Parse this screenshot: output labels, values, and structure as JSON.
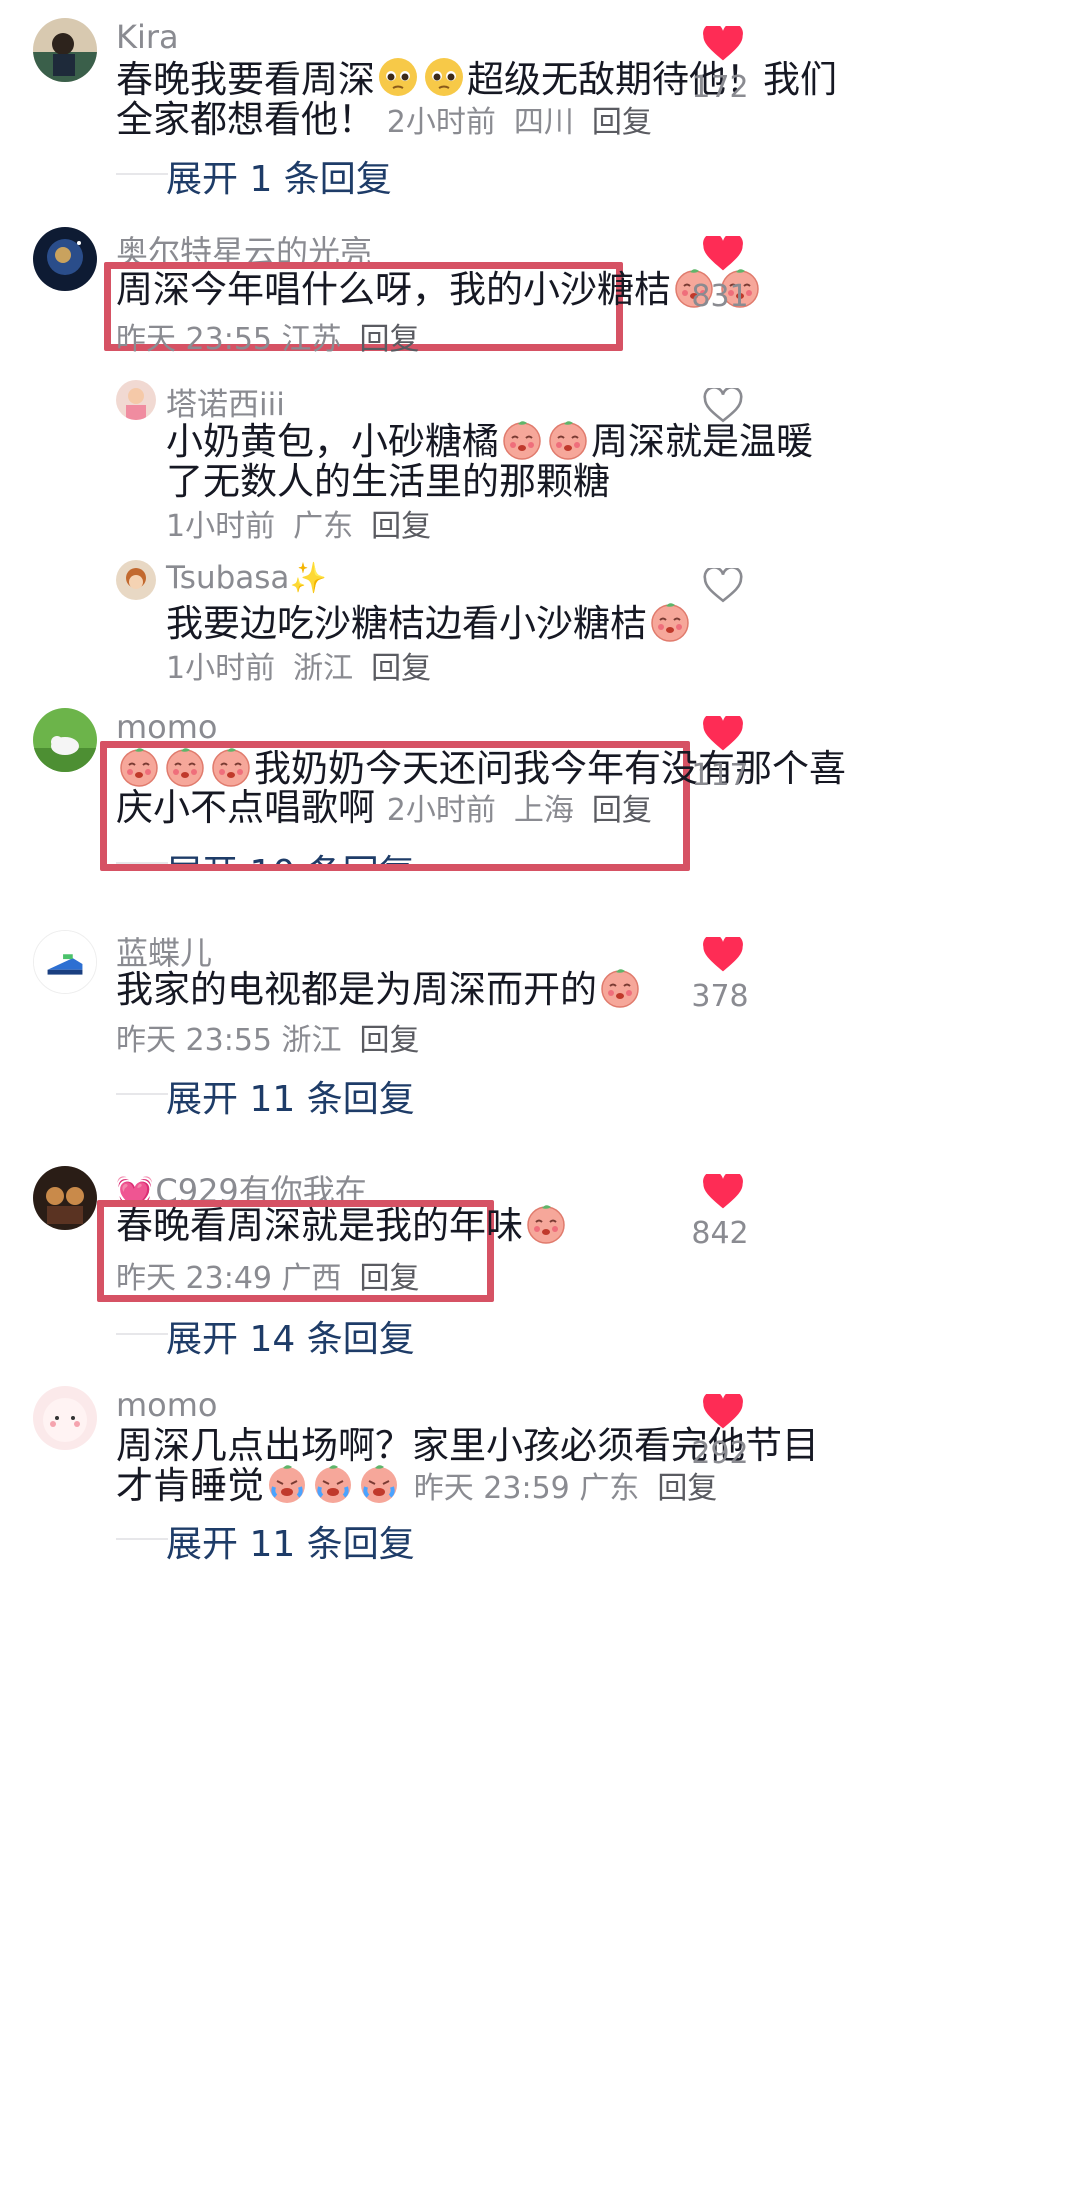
{
  "comments": [
    {
      "username": "Kira",
      "text_1": "春晚我要看周深",
      "text_2": "超级无敌期待他！我们",
      "text_3": "全家都想看他！",
      "time": "2小时前",
      "location": "四川",
      "reply": "回复",
      "expand": "展开 1 条回复",
      "likes": "172",
      "liked": true
    },
    {
      "username": "奥尔特星云的光亮",
      "text_1": "周深今年唱什么呀，我的小沙糖桔",
      "time": "昨天 23:55",
      "location": "江苏",
      "reply": "回复",
      "likes": "831",
      "liked": true,
      "replies": [
        {
          "username": "塔诺西iii",
          "text_1": "小奶黄包，小砂糖橘",
          "text_2": "周深就是温暖",
          "text_3": "了无数人的生活里的那颗糖",
          "time": "1小时前",
          "location": "广东",
          "reply": "回复",
          "liked": false
        },
        {
          "username": "Tsubasa",
          "text_1": "我要边吃沙糖桔边看小沙糖桔",
          "time": "1小时前",
          "location": "浙江",
          "reply": "回复",
          "liked": false
        }
      ]
    },
    {
      "username": "momo",
      "text_1": "我奶奶今天还问我今年有没有那个喜",
      "text_2": "庆小不点唱歌啊",
      "time": "2小时前",
      "location": "上海",
      "reply": "回复",
      "expand": "展开 10 条回复",
      "likes": "117",
      "liked": true
    },
    {
      "username": "蓝蝶儿",
      "text_1": "我家的电视都是为周深而开的",
      "time": "昨天 23:55",
      "location": "浙江",
      "reply": "回复",
      "expand": "展开 11 条回复",
      "likes": "378",
      "liked": true
    },
    {
      "username": "C929有你我在",
      "text_1": "春晚看周深就是我的年味",
      "time": "昨天 23:49",
      "location": "广西",
      "reply": "回复",
      "expand": "展开 14 条回复",
      "likes": "842",
      "liked": true
    },
    {
      "username": "momo",
      "text_1": "周深几点出场啊？家里小孩必须看完他节目",
      "text_2": "才肯睡觉",
      "time": "昨天 23:59",
      "location": "广东",
      "reply": "回复",
      "expand": "展开 11 条回复",
      "likes": "292",
      "liked": true
    }
  ],
  "colors": {
    "like_red": "#fe2c55",
    "highlight_box": "#d65264",
    "expand_blue": "#1e3c68",
    "meta_gray": "#8a8b91"
  },
  "icons": {
    "like": "heart-icon",
    "emoji": "peach-emoji-icon"
  }
}
